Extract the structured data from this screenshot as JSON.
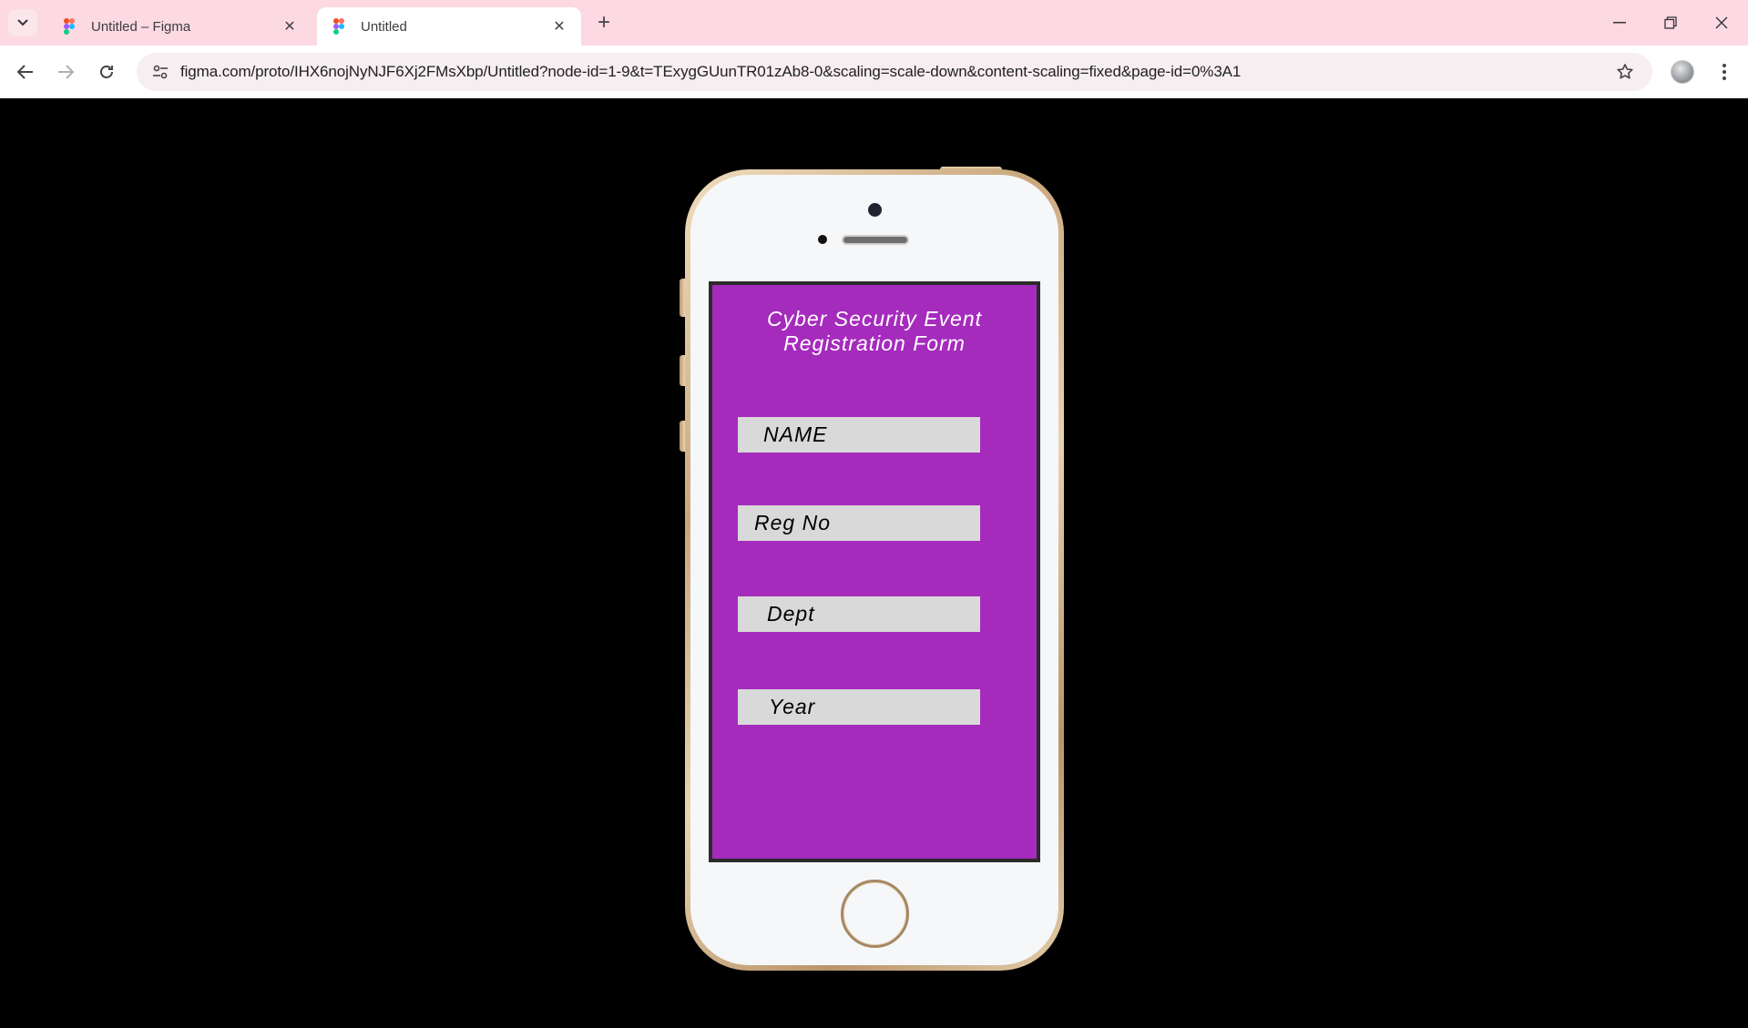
{
  "browser": {
    "tabs": [
      {
        "title": "Untitled – Figma",
        "active": false
      },
      {
        "title": "Untitled",
        "active": true
      }
    ],
    "url": "figma.com/proto/IHX6nojNyNJF6Xj2FMsXbp/Untitled?node-id=1-9&t=TExygGUunTR01zAb8-0&scaling=scale-down&content-scaling=fixed&page-id=0%3A1",
    "icons": {
      "tab_search": "chevron-down-icon",
      "new_tab": "plus-icon",
      "back": "arrow-left-icon",
      "forward": "arrow-right-icon",
      "reload": "reload-icon",
      "site_info": "tune-icon",
      "bookmark": "star-icon",
      "menu": "more-vertical-icon"
    }
  },
  "prototype": {
    "device": "iPhone SE gold",
    "screen_color": "#a52bbd",
    "title": "Cyber Security Event Registration Form",
    "fields": [
      {
        "label": "NAME"
      },
      {
        "label": "Reg No"
      },
      {
        "label": "Dept"
      },
      {
        "label": "Year"
      }
    ]
  }
}
